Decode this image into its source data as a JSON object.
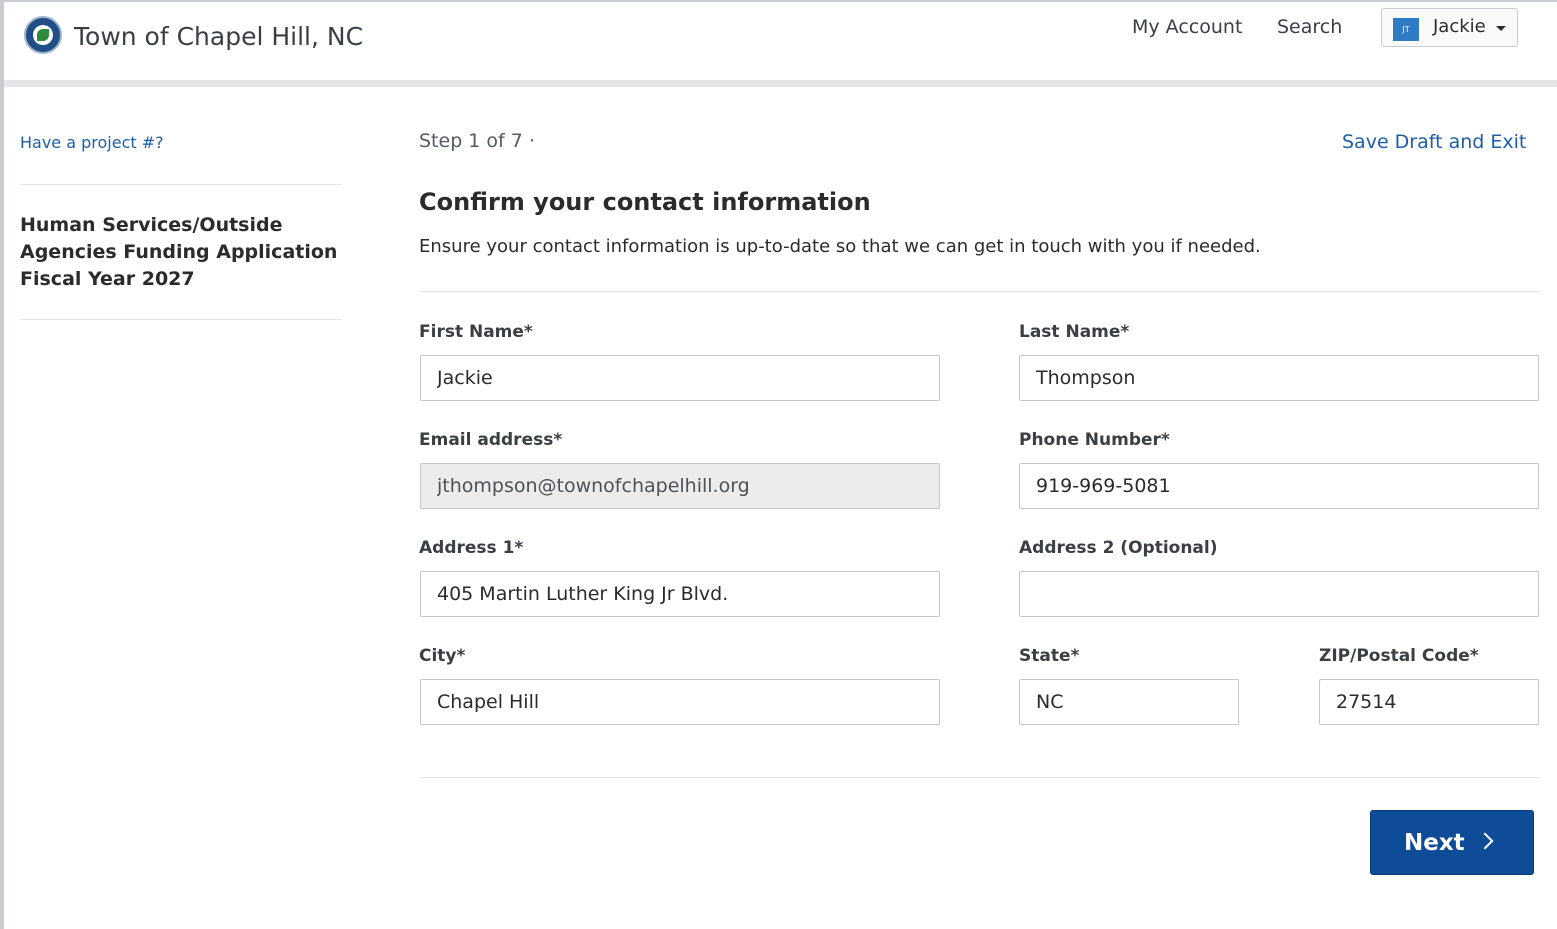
{
  "header": {
    "site_title": "Town of Chapel Hill, NC",
    "nav": {
      "my_account": "My Account",
      "search": "Search"
    },
    "user": {
      "initials": "JT",
      "name": "Jackie"
    }
  },
  "sidebar": {
    "project_link": "Have a project #?",
    "application_title": "Human Services/Outside Agencies Funding Application Fiscal Year 2027"
  },
  "main": {
    "step": "Step 1 of 7 ·",
    "save_draft": "Save Draft and Exit",
    "heading": "Confirm your contact information",
    "subtext": "Ensure your contact information is up-to-date so that we can get in touch with you if needed.",
    "fields": {
      "first_name": {
        "label": "First Name*",
        "value": "Jackie"
      },
      "last_name": {
        "label": "Last Name*",
        "value": "Thompson"
      },
      "email": {
        "label": "Email address*",
        "value": "jthompson@townofchapelhill.org"
      },
      "phone": {
        "label": "Phone Number*",
        "value": "919-969-5081"
      },
      "address1": {
        "label": "Address 1*",
        "value": "405 Martin Luther King Jr Blvd."
      },
      "address2": {
        "label": "Address 2 (Optional)",
        "value": ""
      },
      "city": {
        "label": "City*",
        "value": "Chapel Hill"
      },
      "state": {
        "label": "State*",
        "value": "NC"
      },
      "zip": {
        "label": "ZIP/Postal Code*",
        "value": "27514"
      }
    },
    "next_button": "Next"
  },
  "colors": {
    "link": "#1c5fa8",
    "primary_button": "#0f4c97",
    "readonly_field": "#ececec"
  }
}
